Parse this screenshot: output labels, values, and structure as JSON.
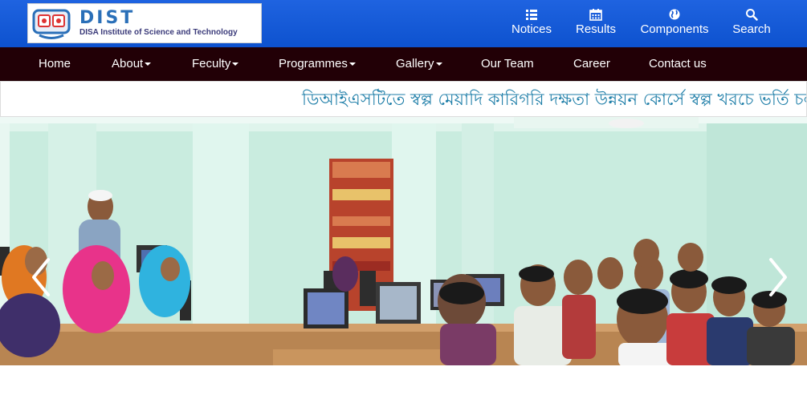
{
  "header": {
    "logo": {
      "title": "DIST",
      "subtitle": "DISA Institute of Science and Technology"
    },
    "quick_links": [
      {
        "label": "Notices",
        "icon": "list-icon"
      },
      {
        "label": "Results",
        "icon": "calendar-icon"
      },
      {
        "label": "Components",
        "icon": "globe-icon"
      },
      {
        "label": "Search",
        "icon": "search-icon"
      }
    ]
  },
  "nav": {
    "items": [
      {
        "label": "Home",
        "dropdown": false
      },
      {
        "label": "About",
        "dropdown": true
      },
      {
        "label": "Feculty",
        "dropdown": true
      },
      {
        "label": "Programmes",
        "dropdown": true
      },
      {
        "label": "Gallery",
        "dropdown": true
      },
      {
        "label": "Our Team",
        "dropdown": false
      },
      {
        "label": "Career",
        "dropdown": false
      },
      {
        "label": "Contact us",
        "dropdown": false
      }
    ]
  },
  "marquee": {
    "text": "ডিআইএসটিতে স্বল্প মেয়াদি কারিগরি দক্ষতা উন্নয়ন কোর্সে স্বল্প খরচে ভর্তি চলছে"
  },
  "carousel": {
    "prev_icon": "chevron-left-icon",
    "next_icon": "chevron-right-icon"
  },
  "colors": {
    "header_blue": "#0d52cf",
    "nav_dark": "#220006",
    "marquee_text": "#1e7ea8"
  }
}
